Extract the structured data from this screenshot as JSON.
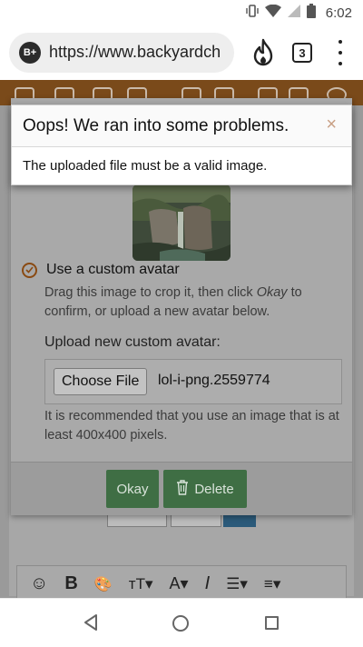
{
  "status_bar": {
    "time": "6:02",
    "icons": [
      "vibrate-icon",
      "wifi-icon",
      "signal-icon",
      "battery-icon"
    ]
  },
  "browser": {
    "site_badge": "B+",
    "url": "https://www.backyardch",
    "tab_count": "3",
    "icons": [
      "fire-icon",
      "tabs-icon",
      "overflow-menu-icon"
    ]
  },
  "error": {
    "title": "Oops! We ran into some problems.",
    "close_symbol": "×",
    "message": "The uploaded file must be a valid image."
  },
  "avatar_dialog": {
    "custom_avatar_label": "Use a custom avatar",
    "custom_avatar_help": "Drag this image to crop it, then click Okay to confirm, or upload a new avatar below.",
    "upload_label": "Upload new custom avatar:",
    "choose_file_label": "Choose File",
    "file_name": "lol-i-png.2559774",
    "recommendation": "It is recommended that you use an image that is at least 400x400 pixels.",
    "okay_label": "Okay",
    "delete_label": "Delete",
    "accent_color": "#3f6e44"
  },
  "editor_toolbar": {
    "tools": [
      "☺",
      "B",
      "🎨",
      "тT▾",
      "A▾",
      "I",
      "☰▾",
      "≡▾"
    ]
  },
  "android_nav": {
    "icons": [
      "back-icon",
      "home-icon",
      "recents-icon"
    ]
  }
}
